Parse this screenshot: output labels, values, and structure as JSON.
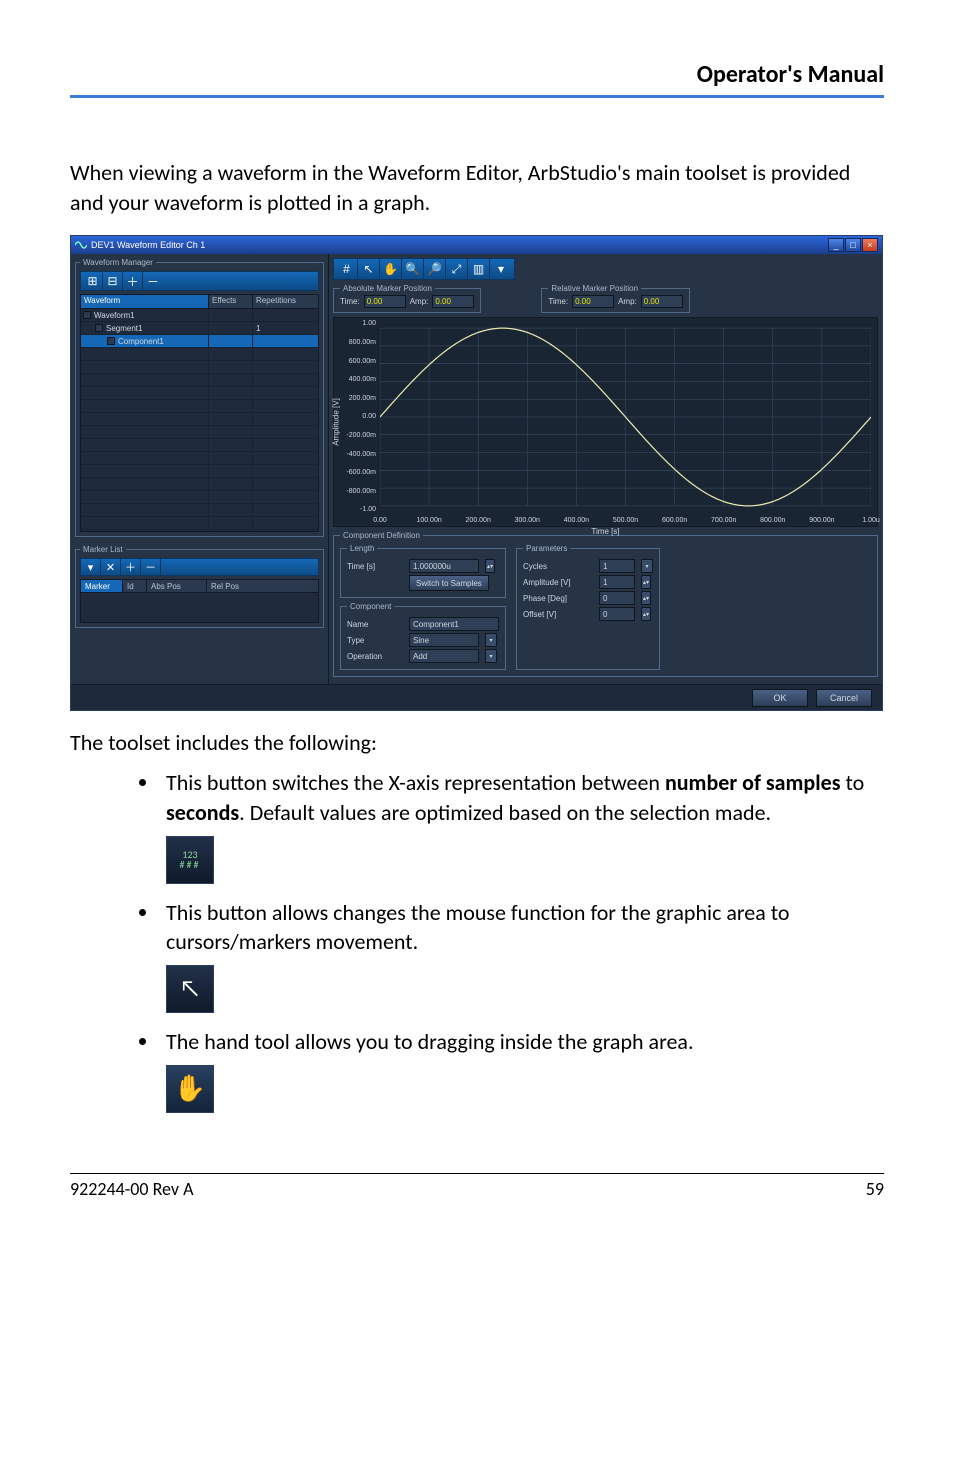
{
  "header": {
    "title": "Operator's Manual"
  },
  "intro": "When viewing a waveform in the Waveform Editor, ArbStudio's main toolset is provided and your waveform is plotted in a graph.",
  "window": {
    "title": "DEV1 Waveform Editor Ch 1",
    "buttons": {
      "min": "_",
      "max": "□",
      "close": "×"
    }
  },
  "waveform_manager": {
    "legend": "Waveform Manager",
    "columns": [
      "Waveform",
      "Effects",
      "Repetitions"
    ],
    "rows": [
      {
        "label": "Waveform1",
        "effects": "",
        "reps": "",
        "indent": 0,
        "sel": false
      },
      {
        "label": "Segment1",
        "effects": "",
        "reps": "1",
        "indent": 1,
        "sel": false
      },
      {
        "label": "Component1",
        "effects": "",
        "reps": "",
        "indent": 2,
        "sel": true
      }
    ]
  },
  "marker_list": {
    "legend": "Marker List",
    "columns": [
      "Marker",
      "Id",
      "Abs Pos",
      "Rel Pos"
    ]
  },
  "abs_marker": {
    "legend": "Absolute Marker Position",
    "time_label": "Time:",
    "time": "0.00",
    "amp_label": "Amp:",
    "amp": "0.00"
  },
  "rel_marker": {
    "legend": "Relative Marker Position",
    "time_label": "Time:",
    "time": "0.00",
    "amp_label": "Amp:",
    "amp": "0.00"
  },
  "chart_data": {
    "type": "line",
    "title": "",
    "xlabel": "Time [s]",
    "ylabel": "Amplitude [V]",
    "xlim": [
      0,
      1e-06
    ],
    "ylim": [
      -1.0,
      1.0
    ],
    "xticks": [
      0,
      1e-07,
      2e-07,
      3e-07,
      4e-07,
      5e-07,
      6e-07,
      7e-07,
      8e-07,
      9e-07,
      1e-06
    ],
    "xtick_labels": [
      "0.00",
      "100.00n",
      "200.00n",
      "300.00n",
      "400.00n",
      "500.00n",
      "600.00n",
      "700.00n",
      "800.00n",
      "900.00n",
      "1.00u"
    ],
    "yticks": [
      -1.0,
      -0.8,
      -0.6,
      -0.4,
      -0.2,
      0.0,
      0.2,
      0.4,
      0.6,
      0.8,
      1.0
    ],
    "ytick_labels": [
      "-1.00",
      "-800.00m",
      "-600.00m",
      "-400.00m",
      "-200.00m",
      "0.00",
      "200.00m",
      "400.00m",
      "600.00m",
      "800.00m",
      "1.00"
    ],
    "series": [
      {
        "name": "Component1",
        "fn": "sin(2*pi*1e6*t)",
        "cycles": 1,
        "amplitude": 1,
        "phase_deg": 0,
        "offset_v": 0,
        "length_s": 1e-06
      }
    ]
  },
  "component_definition": {
    "legend": "Component Definition",
    "length": {
      "legend": "Length",
      "time_label": "Time [s]",
      "time_value": "1.000000u",
      "switch_btn": "Switch to Samples"
    },
    "parameters": {
      "legend": "Parameters",
      "rows": [
        {
          "label": "Cycles",
          "value": "1",
          "type": "select"
        },
        {
          "label": "Amplitude [V]",
          "value": "1",
          "type": "spin"
        },
        {
          "label": "Phase [Deg]",
          "value": "0",
          "type": "spin"
        },
        {
          "label": "Offset [V]",
          "value": "0",
          "type": "spin"
        }
      ]
    },
    "component": {
      "legend": "Component",
      "name_label": "Name",
      "name_value": "Component1",
      "type_label": "Type",
      "type_value": "Sine",
      "op_label": "Operation",
      "op_value": "Add"
    }
  },
  "dialog_buttons": {
    "ok": "OK",
    "cancel": "Cancel"
  },
  "after_intro": "The toolset includes the following:",
  "bullets": [
    {
      "pre": "This button switches the X-axis representation between ",
      "b1": "number of samples",
      "mid": " to ",
      "b2": "seconds",
      "post": ". Default values are optimized based on the selection made."
    },
    {
      "text": "This button allows changes the mouse function for the graphic area to cursors/markers movement."
    },
    {
      "text": "The hand tool allows you to dragging inside the graph area."
    }
  ],
  "icon_glyphs": {
    "xaxis": "123\n###",
    "arrow": "↖",
    "hand": "✋"
  },
  "footer": {
    "left": "922244-00 Rev A",
    "right": "59"
  }
}
